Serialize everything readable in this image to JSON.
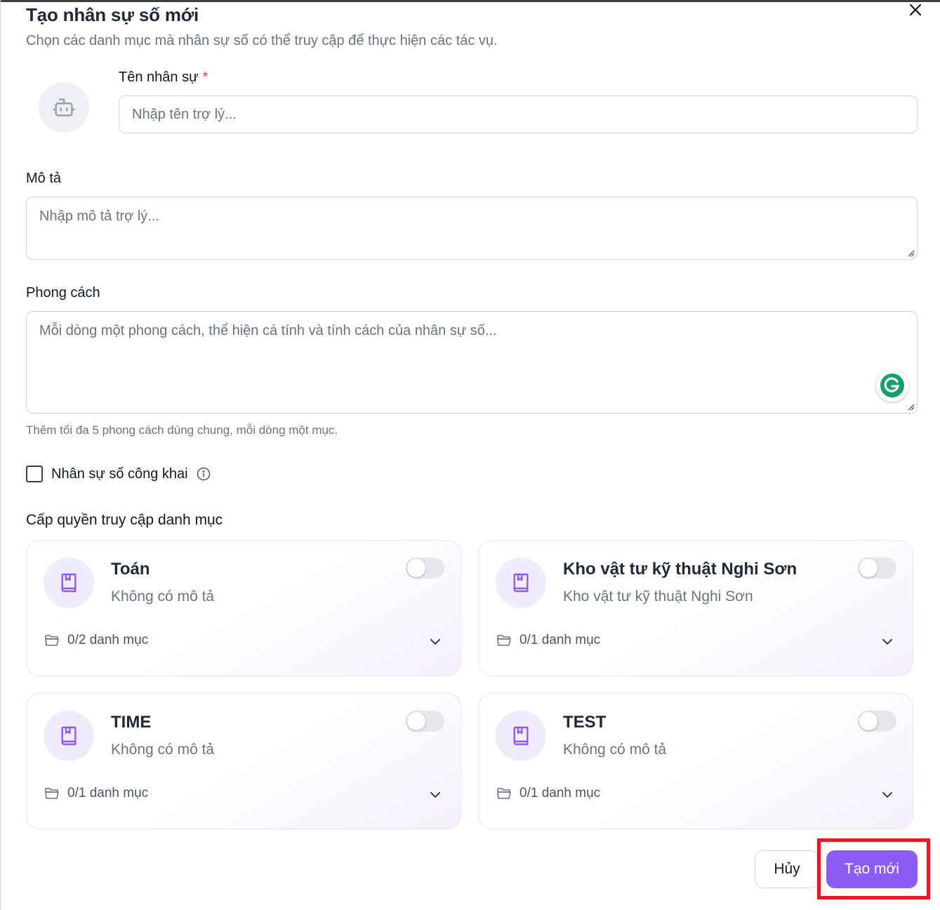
{
  "dialog": {
    "title": "Tạo nhân sự số mới",
    "subtitle": "Chọn các danh mục mà nhân sự số có thể truy cập để thực hiện các tác vụ.",
    "close_icon": "close-icon"
  },
  "form": {
    "name_label": "Tên nhân sự",
    "name_required_mark": "*",
    "name_placeholder": "Nhập tên trợ lý...",
    "description_label": "Mô tả",
    "description_placeholder": "Nhập mô tả trợ lý...",
    "style_label": "Phong cách",
    "style_placeholder": "Mỗi dòng một phong cách, thể hiện cá tính và tính cách của nhân sự số...",
    "style_hint": "Thêm tối đa 5 phong cách dùng chung, mỗi dòng một mục.",
    "public_label": "Nhân sự số công khai",
    "public_checked": false
  },
  "access": {
    "section_title": "Cấp quyền truy cập danh mục",
    "cards": [
      {
        "title": "Toán",
        "description": "Không có mô tả",
        "count": "0/2 danh mục",
        "enabled": false
      },
      {
        "title": "Kho vật tư kỹ thuật Nghi Sơn",
        "description": "Kho vật tư kỹ thuật Nghi Sơn",
        "count": "0/1 danh mục",
        "enabled": false
      },
      {
        "title": "TIME",
        "description": "Không có mô tả",
        "count": "0/1 danh mục",
        "enabled": false
      },
      {
        "title": "TEST",
        "description": "Không có mô tả",
        "count": "0/1 danh mục",
        "enabled": false
      }
    ]
  },
  "actions": {
    "cancel_label": "Hủy",
    "create_label": "Tạo mới"
  },
  "colors": {
    "accent": "#8b5cf6",
    "highlight": "#e11d24"
  }
}
